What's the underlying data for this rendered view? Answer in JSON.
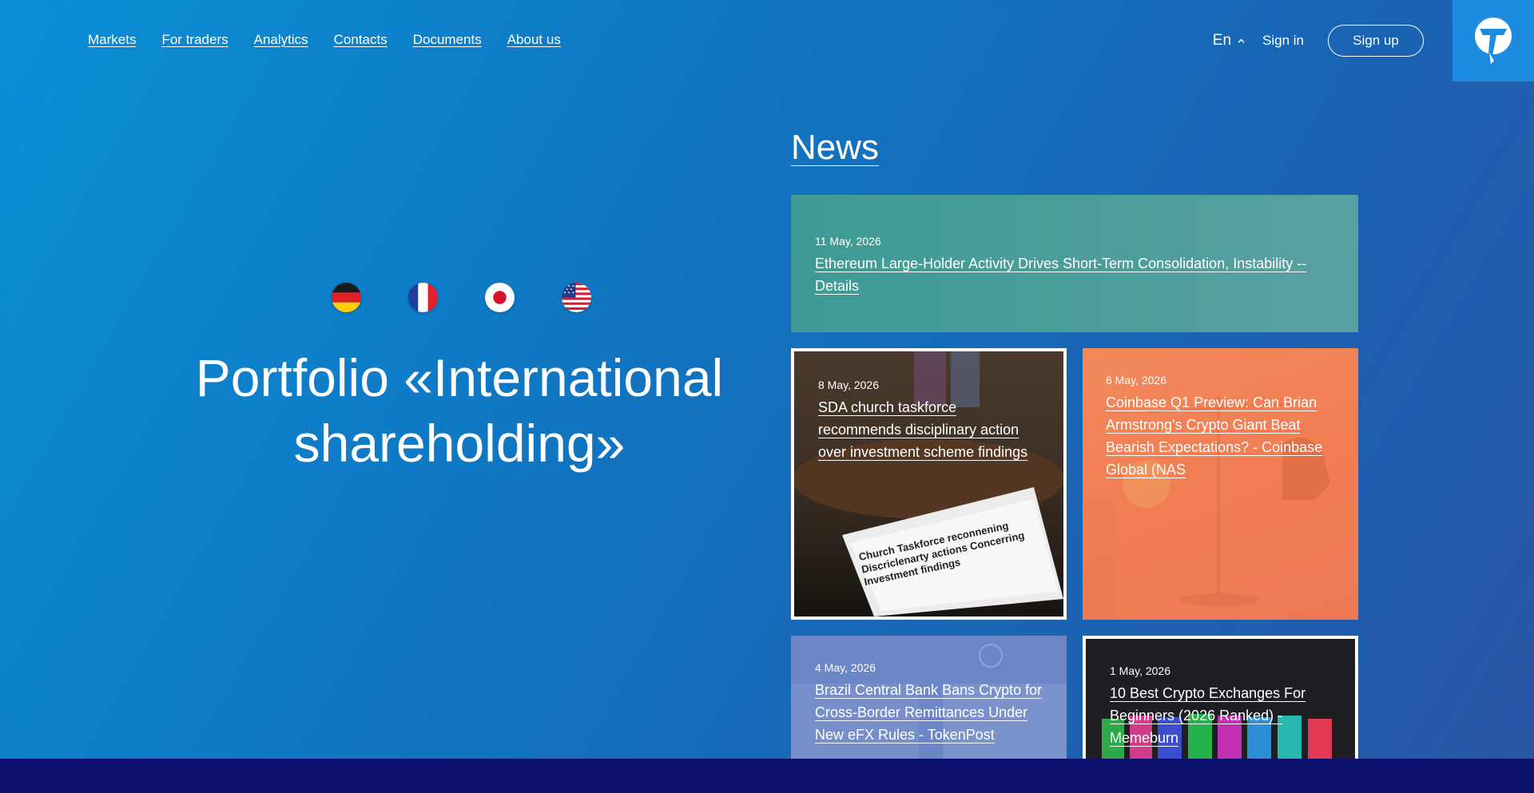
{
  "nav": {
    "items": [
      "Markets",
      "For traders",
      "Analytics",
      "Contacts",
      "Documents",
      "About us"
    ]
  },
  "header": {
    "language": "En",
    "signin_label": "Sign in",
    "signup_label": "Sign up"
  },
  "hero": {
    "flags": [
      "germany-flag-icon",
      "france-flag-icon",
      "japan-flag-icon",
      "usa-flag-icon"
    ],
    "title_line1": "Portfolio «International",
    "title_line2": "shareholding»"
  },
  "news": {
    "heading": "News",
    "items": [
      {
        "date": "11 May, 2026",
        "title": "Ethereum Large-Holder Activity Drives Short-Term Consolidation, Instability -- Details"
      },
      {
        "date": "8 May, 2026",
        "title": "SDA church taskforce recommends disciplinary action over investment scheme findings",
        "image_text": "Church Taskforce reconnening Discriclenarty actions Concerring Investment findings"
      },
      {
        "date": "6 May, 2026",
        "title": "Coinbase Q1 Preview: Can Brian Armstrong's Crypto Giant Beat Bearish Expectations? - Coinbase Global (NAS"
      },
      {
        "date": "4 May, 2026",
        "title": "Brazil Central Bank Bans Crypto for Cross-Border Remittances Under New eFX Rules - TokenPost"
      },
      {
        "date": "1 May, 2026",
        "title": "10 Best Crypto Exchanges For Beginners (2026 Ranked) - Memeburn"
      }
    ]
  },
  "colors": {
    "bg_start": "#0a8fd6",
    "bg_end": "#2a55a6",
    "teal_card": "#4d9f9c",
    "orange_card": "#f27d52",
    "bottom_band": "#0b0f6e"
  }
}
